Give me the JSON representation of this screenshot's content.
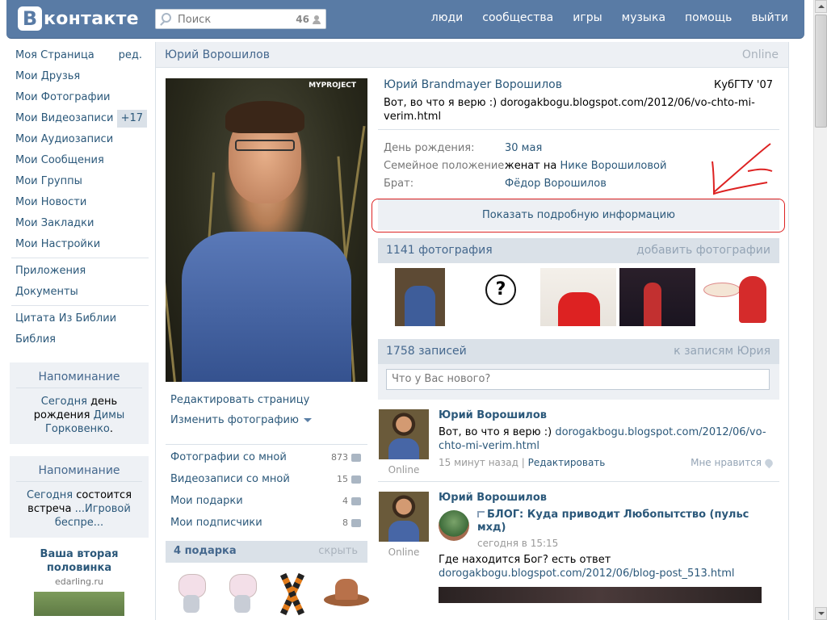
{
  "header": {
    "logo_letter": "В",
    "logo_text": "контакте",
    "search_placeholder": "Поиск",
    "search_count": "46",
    "nav": [
      "люди",
      "сообщества",
      "игры",
      "музыка",
      "помощь",
      "выйти"
    ]
  },
  "leftmenu": {
    "items": [
      {
        "label": "Моя Страница",
        "side": "ред."
      },
      {
        "label": "Мои Друзья"
      },
      {
        "label": "Мои Фотографии"
      },
      {
        "label": "Мои Видеозаписи",
        "badge": "+17"
      },
      {
        "label": "Мои Аудиозаписи"
      },
      {
        "label": "Мои Сообщения"
      },
      {
        "label": "Мои Группы"
      },
      {
        "label": "Мои Новости"
      },
      {
        "label": "Мои Закладки"
      },
      {
        "label": "Мои Настройки"
      }
    ],
    "apps": [
      "Приложения",
      "Документы"
    ],
    "extra": [
      "Цитата Из Библии",
      "Библия"
    ],
    "reminder1": {
      "title": "Напоминание",
      "w1": "Сегодня",
      "w2": " день рождения ",
      "w3": "Димы Горковенко",
      "w4": "."
    },
    "reminder2": {
      "title": "Напоминание",
      "w1": "Сегодня",
      "w2": " состоится встреча ",
      "w3": "...Игровой беспре..."
    },
    "ad": {
      "title": "Ваша вторая половинка",
      "domain": "edarling.ru"
    }
  },
  "profile": {
    "header_name": "Юрий Ворошилов",
    "online": "Online",
    "photo_watermark": "MYPROJECT",
    "full_name": "Юрий Brandmayer Ворошилов",
    "university": "КубГТУ '07",
    "status": "Вот, во что я верю :) dorogakbogu.blogspot.com/2012/06/vo-chto-mi-verim.html",
    "info": [
      {
        "label": "День рождения:",
        "value": "30 мая"
      },
      {
        "label": "Семейное положение:",
        "value_prefix": "женат на ",
        "value": "Нике Ворошиловой"
      },
      {
        "label": "Брат:",
        "value": "Фёдор Ворошилов"
      }
    ],
    "show_more": "Показать подробную информацию",
    "edit_page": "Редактировать страницу",
    "change_photo": "Изменить фотографию",
    "counts": [
      {
        "label": "Фотографии со мной",
        "num": "873"
      },
      {
        "label": "Видеозаписи со мной",
        "num": "15"
      },
      {
        "label": "Мои подарки",
        "num": "4"
      },
      {
        "label": "Мои подписчики",
        "num": "8"
      }
    ],
    "gifts_title": "4 подарка",
    "gifts_hide": "скрыть"
  },
  "photos": {
    "title": "1141 фотография",
    "add": "добавить фотографии"
  },
  "wall": {
    "title": "1758 записей",
    "link": "к записям Юрия",
    "placeholder": "Что у Вас нового?",
    "posts": [
      {
        "author": "Юрий Ворошилов",
        "text_pre": "Вот, во что я верю :) ",
        "text_link": "dorogakbogu.blogspot.com/2012/06/vo-chto-mi-verim.html",
        "time": "15 минут назад",
        "edit": "Редактировать",
        "like": "Мне нравится",
        "online": "Online"
      },
      {
        "author": "Юрий Ворошилов",
        "repost_title": "БЛОГ: Куда приводит Любопытство (пульс мхд)",
        "repost_time": "сегодня в 15:15",
        "text_pre": "Где находится Бог? есть ответ",
        "text_link": "dorogakbogu.blogspot.com/2012/06/blog-post_513.html",
        "online": "Online"
      }
    ]
  },
  "colors": {
    "header": "#597ba5",
    "link": "#2b587a",
    "annotation": "#dd2222"
  }
}
